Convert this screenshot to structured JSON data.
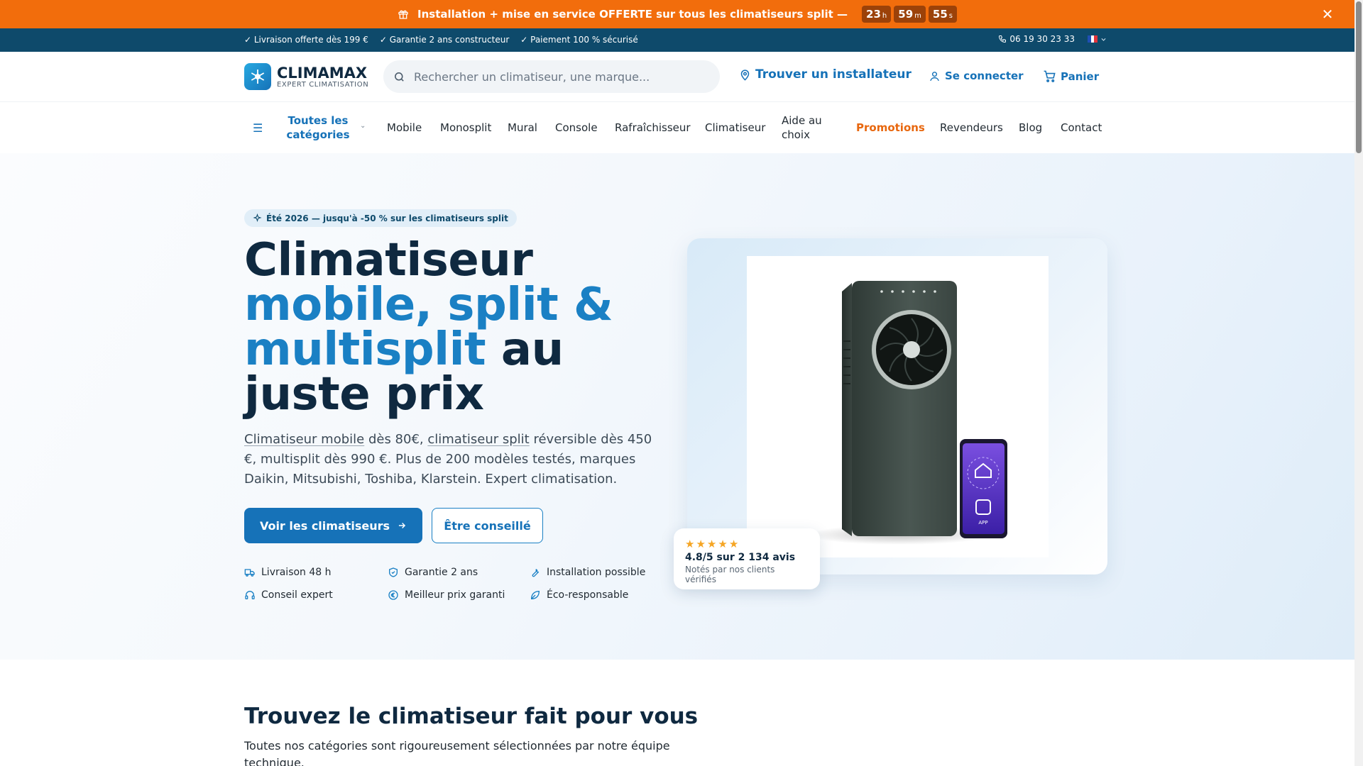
{
  "promo": {
    "text": "Installation + mise en service OFFERTE sur tous les climatiseurs split —",
    "countdown": [
      {
        "value": "23",
        "unit": "h"
      },
      {
        "value": "59",
        "unit": "m"
      },
      {
        "value": "55",
        "unit": "s"
      }
    ],
    "close": "✕"
  },
  "infobar": {
    "items": [
      "✓ Livraison offerte dès 199 €",
      "✓ Garantie 2 ans constructeur",
      "✓ Paiement 100 % sécurisé"
    ],
    "phone": "06 19 30 23 33"
  },
  "header": {
    "brand": "CLIMAMAX",
    "tagline": "EXPERT CLIMATISATION",
    "search_placeholder": "Rechercher un climatiseur, une marque...",
    "installer": "Trouver un installateur",
    "login": "Se connecter",
    "cart": "Panier"
  },
  "nav": {
    "all_categories": "Toutes les catégories",
    "items": [
      "Mobile",
      "Monosplit",
      "Mural",
      "Console",
      "Rafraîchisseur",
      "Climatiseur",
      "Aide au choix",
      "Promotions",
      "Revendeurs",
      "Blog",
      "Contact"
    ]
  },
  "hero": {
    "badge": "Été 2026 — jusqu'à -50 % sur les climatiseurs split",
    "title_1": "Climatiseur",
    "title_blue": "mobile, split & multisplit",
    "title_2": "au juste prix",
    "lead_link1": "Climatiseur mobile",
    "lead_t1": " dès 80€, ",
    "lead_link2": "climatiseur split",
    "lead_t2": " réversible dès 450 €, multisplit dès 990 €. Plus de 200 modèles testés, marques Daikin, Mitsubishi, Toshiba, Klarstein. Expert climatisation.",
    "cta_primary": "Voir les climatiseurs",
    "cta_secondary": "Être conseillé",
    "features": [
      "Livraison 48 h",
      "Garantie 2 ans",
      "Installation possible",
      "Conseil expert",
      "Meilleur prix garanti",
      "Éco-responsable"
    ],
    "phone_app_label": "APP",
    "rating": {
      "value": 4.8,
      "score": "4.8/5 sur 2 134 avis",
      "note": "Notés par nos clients vérifiés"
    }
  },
  "section": {
    "title": "Trouvez le climatiseur fait pour vous",
    "lead": "Toutes nos catégories sont rigoureusement sélectionnées par notre équipe technique."
  },
  "colors": {
    "promo_orange": "#f26d0c",
    "infobar_navy": "#0e4a6b",
    "brand_blue": "#1672b8",
    "accent_blue": "#1a80c4",
    "promotions_orange": "#e8670e",
    "star_gold": "#f5a524"
  },
  "icons": [
    "gift-icon",
    "close-icon",
    "phone-icon",
    "flag-fr-icon",
    "snowflake-logo-icon",
    "search-icon",
    "map-pin-icon",
    "user-icon",
    "cart-icon",
    "menu-icon",
    "chevron-down-icon",
    "sparkle-icon",
    "arrow-right-icon",
    "truck-icon",
    "shield-check-icon",
    "wrench-icon",
    "headset-icon",
    "euro-badge-icon",
    "leaf-icon",
    "star-icon"
  ]
}
